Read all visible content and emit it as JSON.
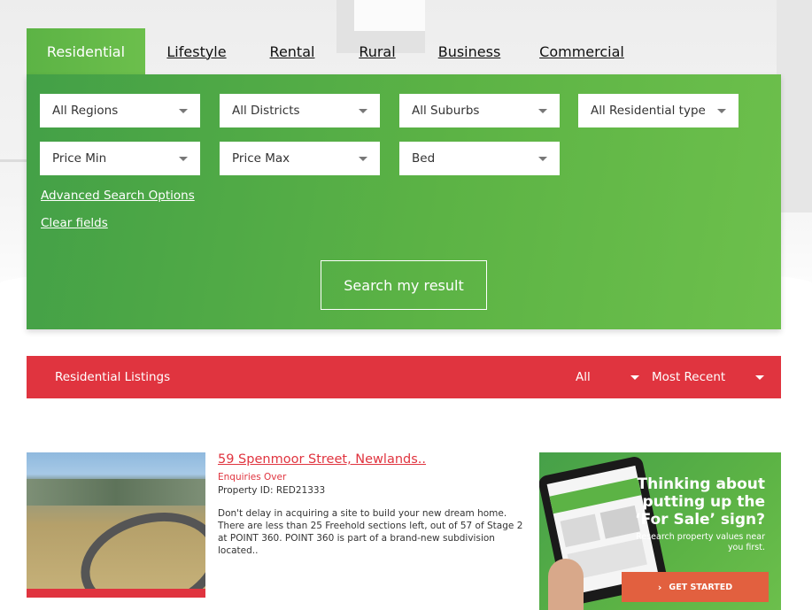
{
  "tabs": [
    {
      "label": "Residential",
      "active": true
    },
    {
      "label": "Lifestyle",
      "active": false
    },
    {
      "label": "Rental",
      "active": false
    },
    {
      "label": "Rural",
      "active": false
    },
    {
      "label": "Business",
      "active": false
    },
    {
      "label": "Commercial",
      "active": false
    }
  ],
  "search": {
    "regions": "All Regions",
    "districts": "All Districts",
    "suburbs": "All Suburbs",
    "residential_type": "All Residential type",
    "price_min": "Price Min",
    "price_max": "Price Max",
    "bed": "Bed",
    "advanced_link": "Advanced Search Options",
    "clear_link": "Clear fields",
    "search_button": "Search my result"
  },
  "listings_bar": {
    "title": "Residential Listings",
    "filter": "All",
    "sort": "Most Recent"
  },
  "listing": {
    "title": "59 Spenmoor Street, Newlands..",
    "status": "Enquiries Over",
    "property_id": "Property ID: RED21333",
    "description": "Don't delay in acquiring a site to build your new dream home. There are less than 25 Freehold sections left, out of 57 of Stage 2 at POINT 360. POINT 360 is part of a brand-new subdivision located.."
  },
  "ad": {
    "headline": "Thinking about putting up the ‘For Sale’ sign?",
    "subtext": "Research property values near you first.",
    "button": "GET STARTED"
  },
  "colors": {
    "green_dark": "#43a047",
    "green_light": "#6dc04c",
    "red": "#e0343f",
    "orange": "#e2603f"
  }
}
